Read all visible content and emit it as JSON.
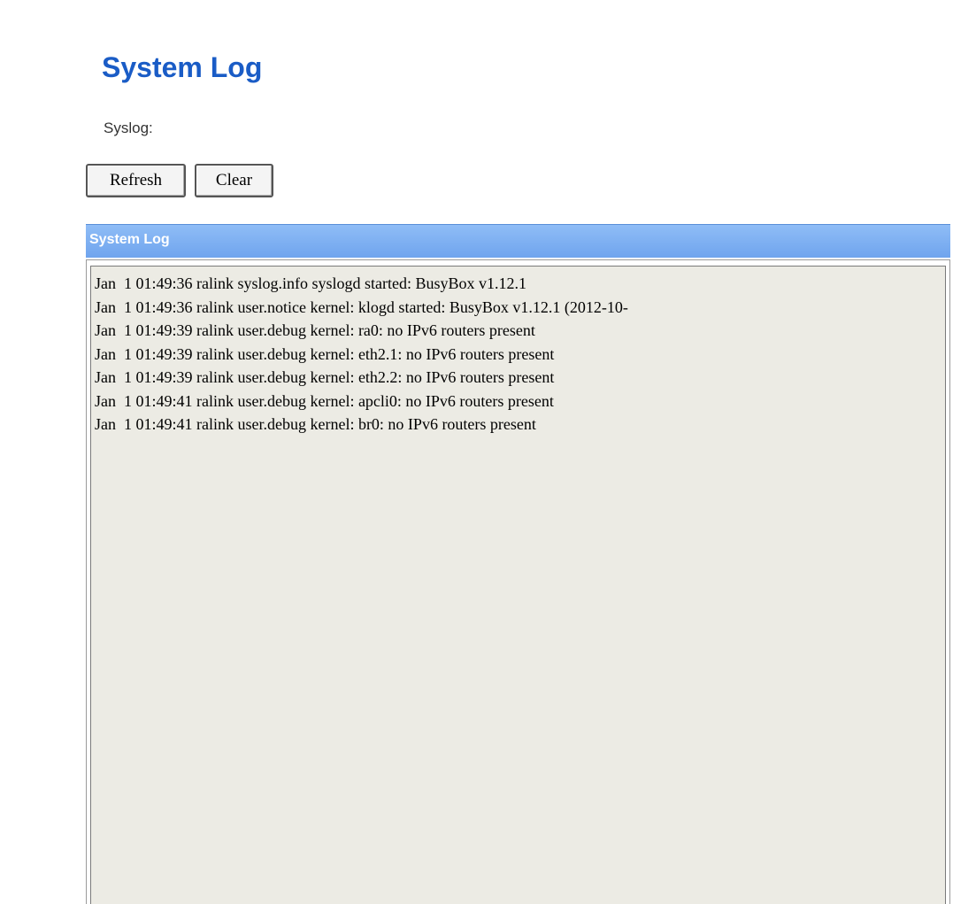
{
  "page": {
    "title": "System Log",
    "syslog_label": "Syslog:"
  },
  "toolbar": {
    "refresh_label": "Refresh",
    "clear_label": "Clear"
  },
  "log_panel": {
    "header": "System Log",
    "lines": [
      "Jan  1 01:49:36 ralink syslog.info syslogd started: BusyBox v1.12.1",
      "Jan  1 01:49:36 ralink user.notice kernel: klogd started: BusyBox v1.12.1 (2012-10-",
      "Jan  1 01:49:39 ralink user.debug kernel: ra0: no IPv6 routers present",
      "Jan  1 01:49:39 ralink user.debug kernel: eth2.1: no IPv6 routers present",
      "Jan  1 01:49:39 ralink user.debug kernel: eth2.2: no IPv6 routers present",
      "Jan  1 01:49:41 ralink user.debug kernel: apcli0: no IPv6 routers present",
      "Jan  1 01:49:41 ralink user.debug kernel: br0: no IPv6 routers present"
    ]
  },
  "colors": {
    "title": "#1a5cc6",
    "header_bar": "#7aaef1",
    "log_background": "#ecebe4"
  }
}
